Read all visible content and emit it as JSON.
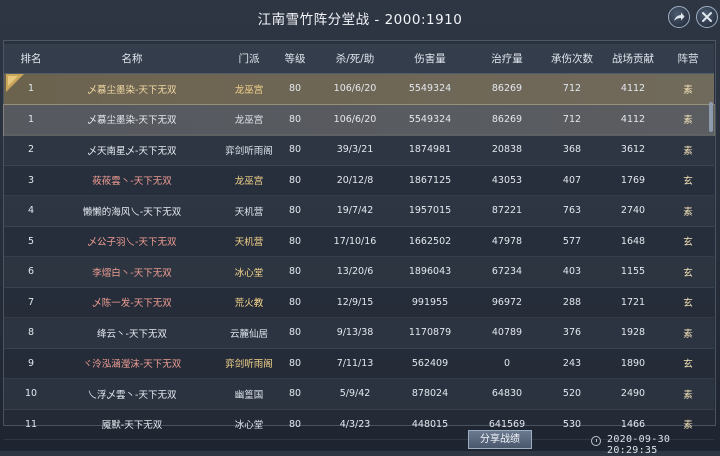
{
  "title": "江南雪竹阵分堂战 - 2000:1910",
  "headers": {
    "rank": "排名",
    "name": "名称",
    "faction": "门派",
    "level": "等级",
    "ksd": "杀/死/助",
    "damage": "伤害量",
    "heal": "治疗量",
    "hits": "承伤次数",
    "contrib": "战场贡献",
    "camp": "阵营"
  },
  "rows": [
    {
      "rank": "1",
      "name": "乄慕尘墨染-天下无双",
      "faction": "龙巫宫",
      "level": "80",
      "ksd": "106/6/20",
      "damage": "5549324",
      "heal": "86269",
      "hits": "712",
      "contrib": "4112",
      "camp": "素",
      "style": "self",
      "nameColor": "gold",
      "facColor": "gold"
    },
    {
      "rank": "1",
      "name": "乄慕尘墨染-天下无双",
      "faction": "龙巫宫",
      "level": "80",
      "ksd": "106/6/20",
      "damage": "5549324",
      "heal": "86269",
      "hits": "712",
      "contrib": "4112",
      "camp": "素",
      "style": "highlight",
      "nameColor": "white",
      "facColor": "white"
    },
    {
      "rank": "2",
      "name": "乄天南星乄-天下无双",
      "faction": "弈剑听雨阁",
      "level": "80",
      "ksd": "39/3/21",
      "damage": "1874981",
      "heal": "20838",
      "hits": "368",
      "contrib": "3612",
      "camp": "素",
      "style": "",
      "nameColor": "white",
      "facColor": "white"
    },
    {
      "rank": "3",
      "name": "莜莜雲丶-天下无双",
      "faction": "龙巫宫",
      "level": "80",
      "ksd": "20/12/8",
      "damage": "1867125",
      "heal": "43053",
      "hits": "407",
      "contrib": "1769",
      "camp": "玄",
      "style": "",
      "nameColor": "red",
      "facColor": "gold"
    },
    {
      "rank": "4",
      "name": "懒懒的海风乀-天下无双",
      "faction": "天机营",
      "level": "80",
      "ksd": "19/7/42",
      "damage": "1957015",
      "heal": "87221",
      "hits": "763",
      "contrib": "2740",
      "camp": "素",
      "style": "",
      "nameColor": "white",
      "facColor": "white"
    },
    {
      "rank": "5",
      "name": "乄公子羽乀-天下无双",
      "faction": "天机营",
      "level": "80",
      "ksd": "17/10/16",
      "damage": "1662502",
      "heal": "47978",
      "hits": "577",
      "contrib": "1648",
      "camp": "玄",
      "style": "",
      "nameColor": "red",
      "facColor": "gold"
    },
    {
      "rank": "6",
      "name": "李熠白丶-天下无双",
      "faction": "冰心堂",
      "level": "80",
      "ksd": "13/20/6",
      "damage": "1896043",
      "heal": "67234",
      "hits": "403",
      "contrib": "1155",
      "camp": "玄",
      "style": "",
      "nameColor": "red",
      "facColor": "gold"
    },
    {
      "rank": "7",
      "name": "乄陈一发-天下无双",
      "faction": "荒火教",
      "level": "80",
      "ksd": "12/9/15",
      "damage": "991955",
      "heal": "96972",
      "hits": "288",
      "contrib": "1721",
      "camp": "玄",
      "style": "",
      "nameColor": "red",
      "facColor": "gold"
    },
    {
      "rank": "8",
      "name": "绛云丶-天下无双",
      "faction": "云麓仙居",
      "level": "80",
      "ksd": "9/13/38",
      "damage": "1170879",
      "heal": "40789",
      "hits": "376",
      "contrib": "1928",
      "camp": "素",
      "style": "",
      "nameColor": "white",
      "facColor": "white"
    },
    {
      "rank": "9",
      "name": "ヾ泠泓涵瀅沫-天下无双",
      "faction": "弈剑听雨阁",
      "level": "80",
      "ksd": "7/11/13",
      "damage": "562409",
      "heal": "0",
      "hits": "243",
      "contrib": "1890",
      "camp": "玄",
      "style": "",
      "nameColor": "red",
      "facColor": "gold"
    },
    {
      "rank": "10",
      "name": "乀浮乄雲丶-天下无双",
      "faction": "幽篁国",
      "level": "80",
      "ksd": "5/9/42",
      "damage": "878024",
      "heal": "64830",
      "hits": "520",
      "contrib": "2490",
      "camp": "素",
      "style": "",
      "nameColor": "white",
      "facColor": "white"
    },
    {
      "rank": "11",
      "name": "魇默-天下无双",
      "faction": "冰心堂",
      "level": "80",
      "ksd": "4/3/23",
      "damage": "448015",
      "heal": "641569",
      "hits": "530",
      "contrib": "1466",
      "camp": "素",
      "style": "",
      "nameColor": "white",
      "facColor": "white"
    }
  ],
  "share_button": "分享战绩",
  "timestamp": "2020-09-30 20:29:35",
  "icons": {
    "share": "share-arrow-icon",
    "close": "close-icon",
    "clock": "clock-icon",
    "rank_badge": "rank-badge-icon"
  },
  "colors": {
    "gold_text": "#f6d58c",
    "red_name": "#ef9d93",
    "self_row": "#786c52"
  }
}
